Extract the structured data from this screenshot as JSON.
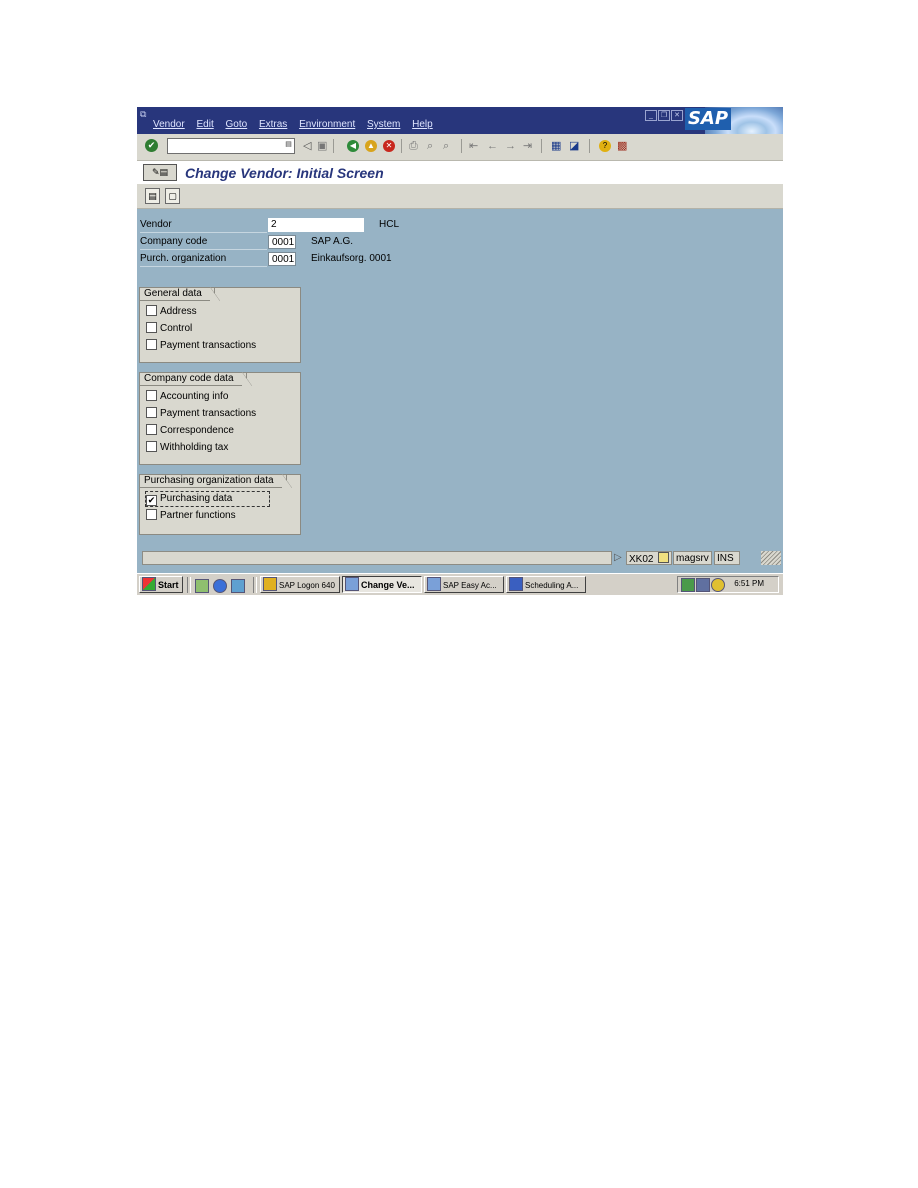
{
  "window": {
    "menu": [
      "Vendor",
      "Edit",
      "Goto",
      "Extras",
      "Environment",
      "System",
      "Help"
    ],
    "logo": "SAP"
  },
  "toolbar": {
    "command_value": "",
    "icons": [
      "enter-icon",
      "save-icon",
      "back-icon",
      "exit-icon",
      "cancel-icon",
      "print-icon",
      "find-icon",
      "find-next-icon",
      "first-page-icon",
      "previous-page-icon",
      "next-page-icon",
      "last-page-icon",
      "create-session-icon",
      "shortcut-icon",
      "help-icon",
      "layout-menu-icon"
    ]
  },
  "screen": {
    "title": "Change Vendor:  Initial Screen"
  },
  "fields": {
    "vendor": {
      "label": "Vendor",
      "value": "2",
      "desc": "HCL"
    },
    "company_code": {
      "label": "Company code",
      "value": "0001",
      "desc": "SAP A.G."
    },
    "purch_org": {
      "label": "Purch. organization",
      "value": "0001",
      "desc": "Einkaufsorg. 0001"
    }
  },
  "groups": {
    "general": {
      "title": "General data",
      "items": [
        {
          "label": "Address",
          "checked": false
        },
        {
          "label": "Control",
          "checked": false
        },
        {
          "label": "Payment transactions",
          "checked": false
        }
      ]
    },
    "company": {
      "title": "Company code data",
      "items": [
        {
          "label": "Accounting info",
          "checked": false
        },
        {
          "label": "Payment transactions",
          "checked": false
        },
        {
          "label": "Correspondence",
          "checked": false
        },
        {
          "label": "Withholding tax",
          "checked": false
        }
      ]
    },
    "purchasing": {
      "title": "Purchasing organization data",
      "items": [
        {
          "label": "Purchasing data",
          "checked": true
        },
        {
          "label": "Partner functions",
          "checked": false
        }
      ]
    }
  },
  "status": {
    "arrow": "▷",
    "transaction": "XK02",
    "server": "magsrv",
    "mode": "INS"
  },
  "taskbar": {
    "start": "Start",
    "buttons": [
      "SAP Logon 640",
      "Change Ve...",
      "SAP Easy Ac...",
      "Scheduling A..."
    ],
    "clock": "6:51 PM"
  }
}
